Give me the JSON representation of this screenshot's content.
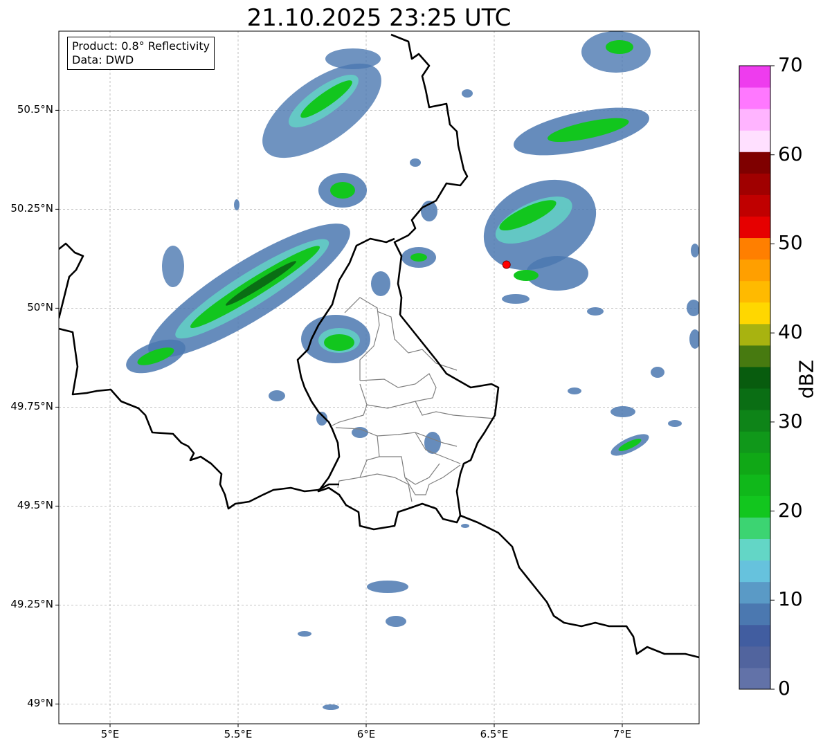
{
  "title": "21.10.2025 23:25 UTC",
  "info": {
    "product": "Product: 0.8° Reflectivity",
    "data": "Data: DWD"
  },
  "axes": {
    "lon_range": [
      4.8,
      7.3
    ],
    "lat_range": [
      48.95,
      50.7
    ],
    "lat_ticks": [
      {
        "value": 50.5,
        "label": "50.5°N"
      },
      {
        "value": 50.25,
        "label": "50.25°N"
      },
      {
        "value": 50.0,
        "label": "50°N"
      },
      {
        "value": 49.75,
        "label": "49.75°N"
      },
      {
        "value": 49.5,
        "label": "49.5°N"
      },
      {
        "value": 49.25,
        "label": "49.25°N"
      },
      {
        "value": 49.0,
        "label": "49°N"
      }
    ],
    "lon_ticks": [
      {
        "value": 5.0,
        "label": "5°E"
      },
      {
        "value": 5.5,
        "label": "5.5°E"
      },
      {
        "value": 6.0,
        "label": "6°E"
      },
      {
        "value": 6.5,
        "label": "6.5°E"
      },
      {
        "value": 7.0,
        "label": "7°E"
      }
    ],
    "grid": true
  },
  "marker": {
    "lon": 6.548,
    "lat": 50.11,
    "color": "#ff0000"
  },
  "colorbar": {
    "label": "dBZ",
    "min": 0,
    "max": 70,
    "ticks": [
      "0",
      "10",
      "20",
      "30",
      "40",
      "50",
      "60",
      "70"
    ],
    "colors": [
      "#6272a8",
      "#51649e",
      "#415da0",
      "#4b78b0",
      "#5a9ac6",
      "#66c2dd",
      "#63d6c6",
      "#3cd472",
      "#12c61e",
      "#10b81a",
      "#10a816",
      "#10981a",
      "#0e8418",
      "#0a6e14",
      "#085c0e",
      "#477a10",
      "#a8b310",
      "#ffd700",
      "#ffba00",
      "#ff9f00",
      "#ff7f00",
      "#e60000",
      "#c00000",
      "#a00000",
      "#7f0000",
      "#ffe0ff",
      "#ffb4ff",
      "#ff78ff",
      "#ee3cee"
    ]
  }
}
